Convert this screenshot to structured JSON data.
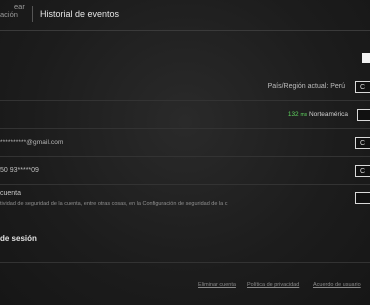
{
  "nav": {
    "security_line1": "ear",
    "security_line2": "ación",
    "history": "Historial de eventos"
  },
  "region": {
    "label": "País/Región actual: Perú",
    "button": "C"
  },
  "ping": {
    "ms": "132",
    "unit": "ms",
    "region": "Norteamérica",
    "button": ""
  },
  "account": {
    "email": "**********@gmail.com",
    "email_button": "C",
    "phone": "50 93*****09",
    "phone_button": "C",
    "security_title": "cuenta",
    "security_desc": "tividad de seguridad de la cuenta, entre otras cosas, en la Configuración de seguridad de la c",
    "security_button": "",
    "logout": "de sesión"
  },
  "footer": {
    "delete": "Eliminar cuenta",
    "privacy": "Política de privacidad",
    "agreement": "Acuerdo de usuario"
  }
}
